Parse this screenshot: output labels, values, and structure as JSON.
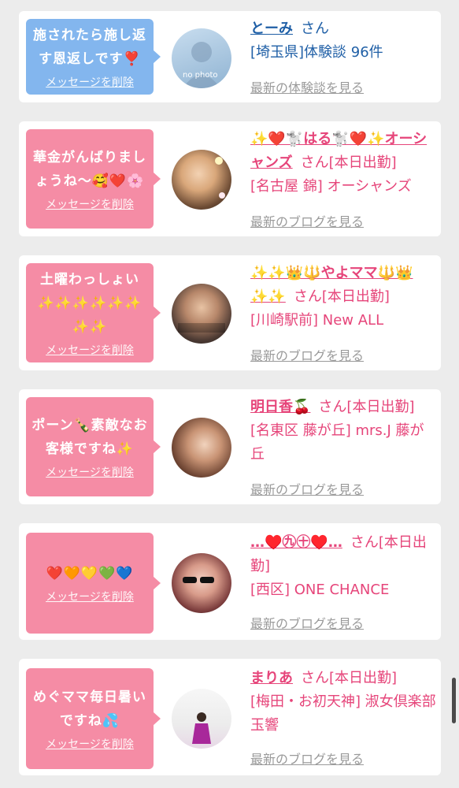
{
  "delete_label": "メッセージを削除",
  "san_label": "さん",
  "cards": [
    {
      "message": "施されたら施し返す恩返しです❣️",
      "name": "とーみ",
      "san": "さん",
      "shop": "[埼玉県]体験談 96件",
      "link": "最新の体験談を見る",
      "avatar_caption": "no photo"
    },
    {
      "message": "華金がんばりましょうね〜🥰❤️🌸",
      "name": "✨❤️🐩はる🐩❤️✨オーシャンズ",
      "san": "さん[本日出勤]",
      "shop": "[名古屋 錦] オーシャンズ",
      "link": "最新のブログを見る"
    },
    {
      "message": "土曜わっしょい ✨✨✨✨✨✨ ✨✨",
      "name": "✨✨👑🔱やよママ🔱👑✨✨",
      "san": "さん[本日出勤]",
      "shop": "[川崎駅前] New ALL",
      "link": "最新のブログを見る"
    },
    {
      "message": "ポーン🍾素敵なお客様ですね✨",
      "name": "明日香🍒",
      "san": "さん[本日出勤]",
      "shop": "[名東区 藤が丘] mrs.J 藤が丘",
      "link": "最新のブログを見る"
    },
    {
      "message": "❤️🧡💛💚💙",
      "name": "…♥️㊈㊉♥️…",
      "san": "さん[本日出勤]",
      "shop": "[西区] ONE CHANCE",
      "link": "最新のブログを見る"
    },
    {
      "message": "めぐママ毎日暑いですね💦",
      "name": "まりあ",
      "san": "さん[本日出勤]",
      "shop": "[梅田・お初天神] 淑女倶楽部 玉響",
      "link": "最新のブログを見る"
    }
  ]
}
